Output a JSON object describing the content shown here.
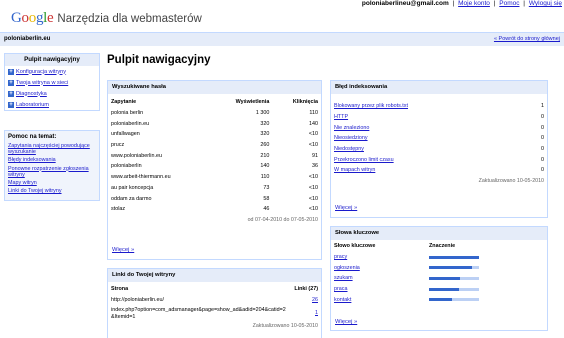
{
  "topbar": {
    "email": "poloniaberlineu@gmail.com",
    "links": [
      "Moje konto",
      "Pomoc",
      "Wyloguj się"
    ]
  },
  "logo": {
    "google": "Google",
    "product": "Narzędzia dla webmasterów"
  },
  "site": {
    "name": "poloniaberlin.eu",
    "home_link": "« Powrót do strony głównej"
  },
  "sidebar": {
    "title": "Pulpit nawigacyjny",
    "items": [
      {
        "label": "Konfiguracja witryny"
      },
      {
        "label": "Twoja witryna w sieci"
      },
      {
        "label": "Diagnostyka"
      },
      {
        "label": "Laboratorium"
      }
    ],
    "help": {
      "title": "Pomoc na temat:",
      "links": [
        "Zapytania najczęściej powodujące wyszukanie",
        "Błędy indeksowania",
        "Ponowne rozpatrzenie zgłoszenia witryny",
        "Mapy witryn",
        "Linki do Twojej witryny"
      ]
    }
  },
  "page_title": "Pulpit nawigacyjny",
  "search_queries": {
    "title": "Wyszukiwane hasła",
    "headers": [
      "Zapytanie",
      "Wyświetlenia",
      "Kliknięcia"
    ],
    "rows": [
      [
        "polonia berlin",
        "1 300",
        "110"
      ],
      [
        "poloniaberlin.eu",
        "320",
        "140"
      ],
      [
        "unfallwagen",
        "320",
        "<10"
      ],
      [
        "prucz",
        "260",
        "<10"
      ],
      [
        "www.poloniaberlin.eu",
        "210",
        "91"
      ],
      [
        "poloniaberlin",
        "140",
        "36"
      ],
      [
        "www.arbeit-thiermann.eu",
        "110",
        "<10"
      ],
      [
        "au pair koncepcja",
        "73",
        "<10"
      ],
      [
        "oddam za darmo",
        "58",
        "<10"
      ],
      [
        "stolaz",
        "46",
        "<10"
      ]
    ],
    "date_range": "od 07-04-2010 do 07-05-2010",
    "more": "Więcej »"
  },
  "links": {
    "title": "Linki do Twojej witryny",
    "headers": [
      "Strona",
      "Linki (27)"
    ],
    "rows": [
      [
        "http://poloniaberlin.eu/",
        "26"
      ],
      [
        "index.php?option=com_adsmanager&page=show_ad&adid=204&catid=2&Itemid=1",
        "1"
      ]
    ],
    "updated": "Zaktualizowano 10-05-2010"
  },
  "crawl_errors": {
    "title": "Błęd indeksowania",
    "rows": [
      [
        "Blokowany przez plik robots.txt",
        "1"
      ],
      [
        "HTTP",
        "0"
      ],
      [
        "Nie znaleziono",
        "0"
      ],
      [
        "Nieosiedziony",
        "0"
      ],
      [
        "Niedostępny",
        "0"
      ],
      [
        "Przekroczono limit czasu",
        "0"
      ],
      [
        "W mapach witryn",
        "0"
      ]
    ],
    "updated": "Zaktualizowano 10-05-2010",
    "more": "Więcej »"
  },
  "keywords": {
    "title": "Słowa kluczowe",
    "headers": [
      "Słowo kluczowe",
      "Znaczenie"
    ],
    "rows": [
      {
        "word": "pracy",
        "significance": 1.0
      },
      {
        "word": "ogłoszenia",
        "significance": 0.85
      },
      {
        "word": "szukam",
        "significance": 0.62
      },
      {
        "word": "praca",
        "significance": 0.6
      },
      {
        "word": "kontakt",
        "significance": 0.45
      }
    ],
    "more": "Więcej »"
  }
}
